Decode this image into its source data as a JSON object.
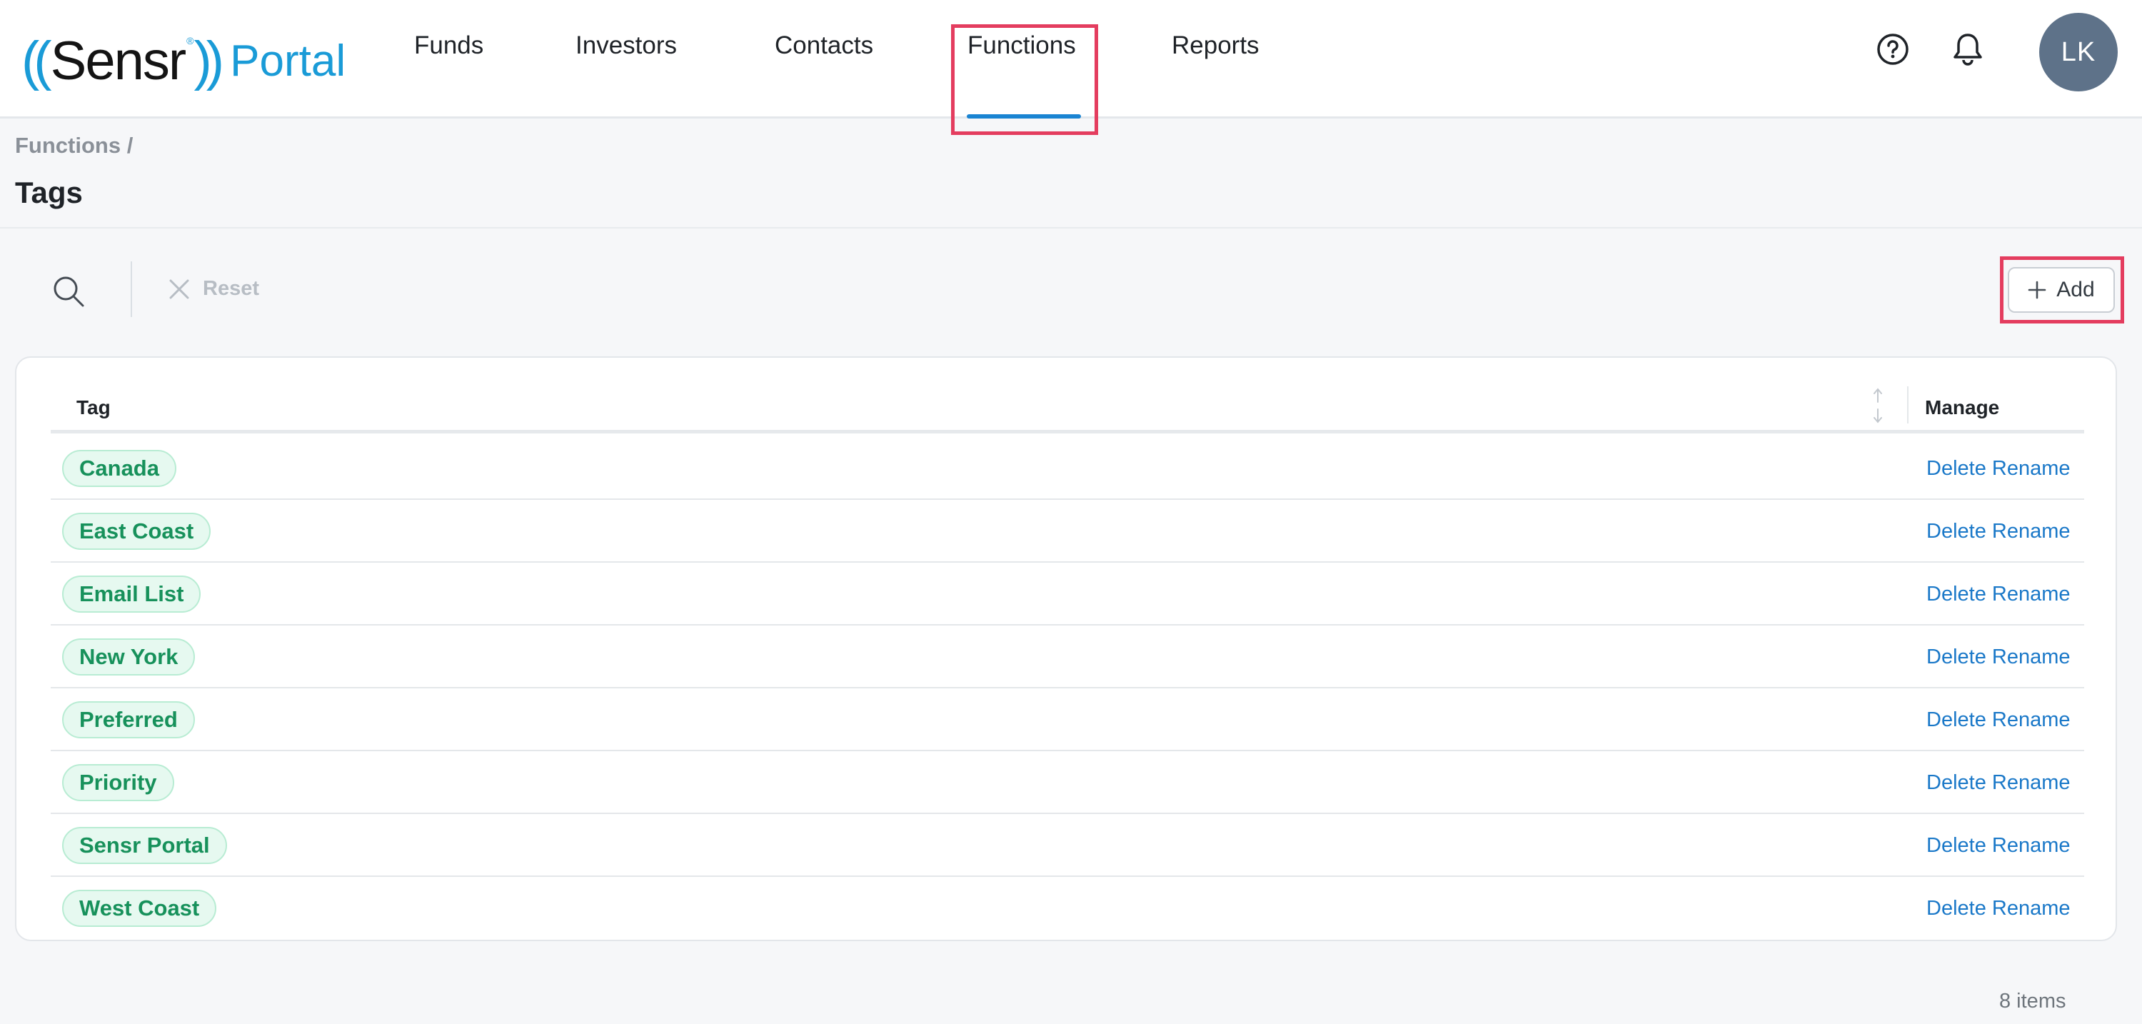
{
  "logo": {
    "parens_left": "((",
    "brand": "Sensr",
    "reg": "®",
    "parens_right": "))",
    "product": "Portal"
  },
  "nav": {
    "funds": "Funds",
    "investors": "Investors",
    "contacts": "Contacts",
    "functions": "Functions",
    "reports": "Reports",
    "active": "Functions"
  },
  "header": {
    "avatar_initials": "LK",
    "help_icon": "help-circle-icon",
    "bell_icon": "bell-icon"
  },
  "breadcrumb": "Functions /",
  "page_title": "Tags",
  "toolbar": {
    "reset_label": "Reset",
    "add_label": "Add",
    "search_icon": "search-icon"
  },
  "table": {
    "columns": {
      "tag": "Tag",
      "manage": "Manage"
    },
    "delete_label": "Delete",
    "rename_label": "Rename",
    "rows": [
      {
        "tag": "Canada"
      },
      {
        "tag": "East Coast"
      },
      {
        "tag": "Email List"
      },
      {
        "tag": "New York"
      },
      {
        "tag": "Preferred"
      },
      {
        "tag": "Priority"
      },
      {
        "tag": "Sensr Portal"
      },
      {
        "tag": "West Coast"
      }
    ]
  },
  "footer": {
    "count": "8 items"
  },
  "colors": {
    "accent": "#1a84d2",
    "highlight": "#e43d5f",
    "tag_text": "#17915b",
    "tag_bg": "#e6f9f0",
    "link": "#1a78c8"
  }
}
